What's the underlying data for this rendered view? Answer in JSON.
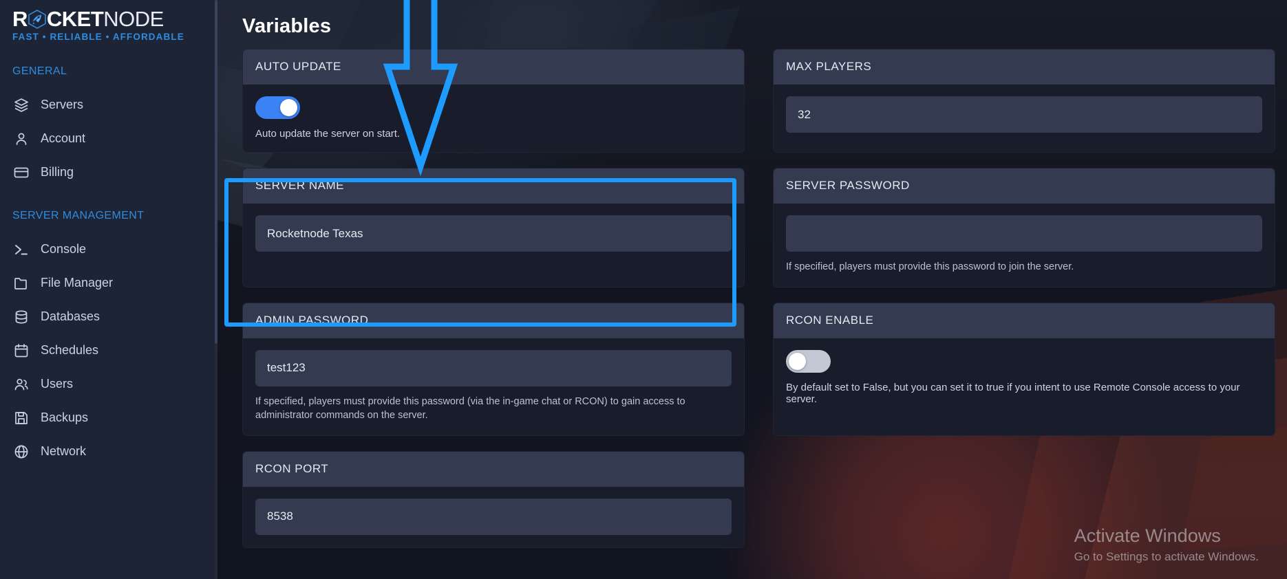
{
  "brand": {
    "name_bold": "R",
    "name_bold2": "CKET",
    "name_light": "NODE",
    "tagline_1": "FAST",
    "tagline_sep": "•",
    "tagline_2": "RELIABLE",
    "tagline_3": "AFFORDABLE",
    "accent_color": "#2f8ce0",
    "rocket_icon": "rocket-icon"
  },
  "sidebar": {
    "sections": [
      {
        "title": "GENERAL",
        "items": [
          {
            "label": "Servers",
            "icon": "layers-icon"
          },
          {
            "label": "Account",
            "icon": "user-icon"
          },
          {
            "label": "Billing",
            "icon": "credit-card-icon"
          }
        ]
      },
      {
        "title": "SERVER MANAGEMENT",
        "items": [
          {
            "label": "Console",
            "icon": "terminal-icon"
          },
          {
            "label": "File Manager",
            "icon": "folder-icon"
          },
          {
            "label": "Databases",
            "icon": "database-icon"
          },
          {
            "label": "Schedules",
            "icon": "calendar-icon"
          },
          {
            "label": "Users",
            "icon": "users-icon"
          },
          {
            "label": "Backups",
            "icon": "save-icon"
          },
          {
            "label": "Network",
            "icon": "globe-icon"
          }
        ]
      }
    ]
  },
  "main": {
    "page_title": "Variables",
    "cards": {
      "auto_update": {
        "title": "AUTO UPDATE",
        "toggle_state": "on",
        "help": "Auto update the server on start."
      },
      "max_players": {
        "title": "MAX PLAYERS",
        "value": "32",
        "placeholder": ""
      },
      "server_name": {
        "title": "SERVER NAME",
        "value": "Rocketnode Texas",
        "placeholder": ""
      },
      "server_password": {
        "title": "SERVER PASSWORD",
        "value": "",
        "placeholder": "",
        "help": "If specified, players must provide this password to join the server."
      },
      "admin_password": {
        "title": "ADMIN PASSWORD",
        "value": "test123",
        "placeholder": "",
        "help": "If specified, players must provide this password (via the in-game chat or RCON) to gain access to administrator commands on the server."
      },
      "rcon_enable": {
        "title": "RCON ENABLE",
        "toggle_state": "off",
        "help": "By default set to False, but you can set it to true if you intent to use Remote Console access to your server."
      },
      "rcon_port": {
        "title": "RCON PORT",
        "value": "8538",
        "placeholder": ""
      }
    }
  },
  "annotations": {
    "highlight_color": "#1e9bff",
    "arrow_icon": "down-arrow-annotation",
    "highlight_target": "SERVER NAME"
  },
  "watermark": {
    "line1": "Activate Windows",
    "line2": "Go to Settings to activate Windows."
  }
}
